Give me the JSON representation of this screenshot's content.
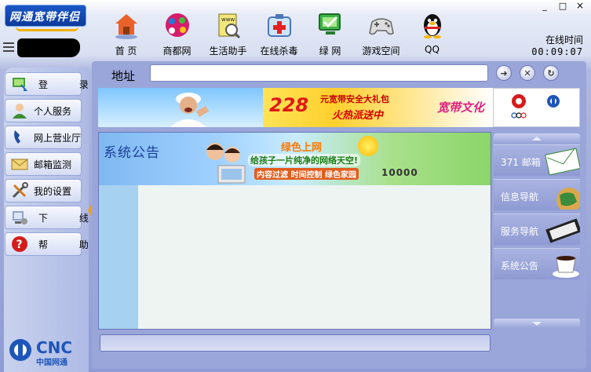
{
  "brand": {
    "name": "网通宽带伴侣"
  },
  "window_controls": {
    "minimize": "_",
    "maximize": "□",
    "close": "×"
  },
  "toolbar": [
    {
      "id": "home",
      "label": "首  页",
      "icon": "home-icon"
    },
    {
      "id": "shangdu",
      "label": "商都网",
      "icon": "shangdu-icon"
    },
    {
      "id": "life",
      "label": "生活助手",
      "icon": "life-assistant-icon"
    },
    {
      "id": "antivirus",
      "label": "在线杀毒",
      "icon": "antivirus-icon"
    },
    {
      "id": "green",
      "label": "绿 网",
      "icon": "green-net-icon"
    },
    {
      "id": "game",
      "label": "游戏空间",
      "icon": "gamepad-icon"
    },
    {
      "id": "qq",
      "label": "QQ",
      "icon": "qq-penguin-icon"
    }
  ],
  "online": {
    "label": "在线时间",
    "time": "00:09:07"
  },
  "sidebar": [
    {
      "label": "登  录",
      "icon": "login-icon"
    },
    {
      "label": "个人服务",
      "icon": "person-icon"
    },
    {
      "label": "网上营业厅",
      "icon": "phone-icon"
    },
    {
      "label": "邮箱监测",
      "icon": "mail-icon"
    },
    {
      "label": "我的设置",
      "icon": "tools-icon"
    },
    {
      "label": "下  线",
      "icon": "logout-icon"
    },
    {
      "label": "帮  助",
      "icon": "help-icon"
    }
  ],
  "footer_logo": {
    "name": "CNC",
    "subtitle": "中国网通"
  },
  "address": {
    "label": "地址",
    "value": ""
  },
  "banner": {
    "big_number": "228",
    "line1": "元宽带安全大礼包",
    "line2": "火热派送中",
    "line3": "宽带文化"
  },
  "notice": {
    "title": "系统公告",
    "banner_heading": "绿色上网",
    "slogan": "给孩子一片纯净的网络天空!",
    "features": "内容过滤 时间控制 绿色家园",
    "number": "10000"
  },
  "right_panel": [
    {
      "label": "371 邮箱",
      "icon": "envelope-icon"
    },
    {
      "label": "信息导航",
      "icon": "globe-icon"
    },
    {
      "label": "服务导航",
      "icon": "keyboard-icon"
    },
    {
      "label": "系统公告",
      "icon": "coffee-cup-icon"
    }
  ],
  "colors": {
    "accent": "#9aa6d9",
    "brand": "#0c3a9a",
    "banner_red": "#e01818"
  }
}
